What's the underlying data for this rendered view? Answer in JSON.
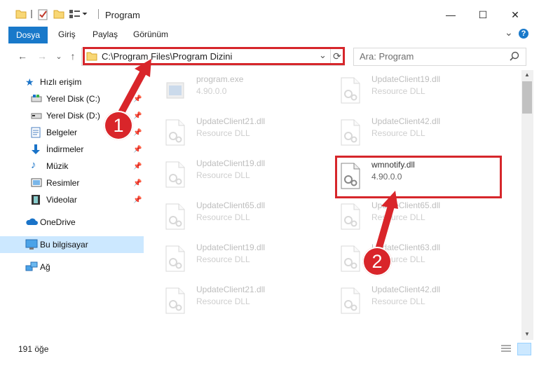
{
  "window": {
    "title": "Program",
    "minimize": "—",
    "maximize": "☐",
    "close": "✕"
  },
  "ribbon": {
    "tabs": [
      "Dosya",
      "Giriş",
      "Paylaş",
      "Görünüm"
    ],
    "expand": "⌄",
    "help": "?"
  },
  "nav": {
    "back": "←",
    "forward": "→",
    "recent": "⌄",
    "up": "↑"
  },
  "address": {
    "path": "C:\\Program Files\\Program Dizini",
    "dropdown": "⌄",
    "refresh": "⟳"
  },
  "search": {
    "placeholder": "Ara: Program",
    "icon": "search-icon"
  },
  "sidebar": {
    "quick_access": "Hızlı erişim",
    "items": [
      {
        "label": "Yerel Disk (C:)",
        "icon": "drive-icon",
        "pinned": true
      },
      {
        "label": "Yerel Disk (D:)",
        "icon": "drive-icon",
        "pinned": true
      },
      {
        "label": "Belgeler",
        "icon": "documents-icon",
        "pinned": true
      },
      {
        "label": "İndirmeler",
        "icon": "download-icon",
        "pinned": true
      },
      {
        "label": "Müzik",
        "icon": "music-icon",
        "pinned": true
      },
      {
        "label": "Resimler",
        "icon": "pictures-icon",
        "pinned": true
      },
      {
        "label": "Videolar",
        "icon": "videos-icon",
        "pinned": true
      }
    ],
    "onedrive": "OneDrive",
    "this_pc": "Bu bilgisayar",
    "network": "Ağ"
  },
  "files": [
    {
      "name": "program.exe",
      "desc": "4.90.0.0"
    },
    {
      "name": "UpdateClient19.dll",
      "desc": "Resource DLL"
    },
    {
      "name": "UpdateClient21.dll",
      "desc": "Resource DLL"
    },
    {
      "name": "UpdateClient42.dll",
      "desc": "Resource DLL"
    },
    {
      "name": "UpdateClient19.dll",
      "desc": "Resource DLL"
    },
    {
      "name": "wmnotify.dll",
      "desc": "4.90.0.0"
    },
    {
      "name": "UpdateClient65.dll",
      "desc": "Resource DLL"
    },
    {
      "name": "UpdateClient65.dll",
      "desc": "Resource DLL"
    },
    {
      "name": "UpdateClient19.dll",
      "desc": "Resource DLL"
    },
    {
      "name": "UpdateClient63.dll",
      "desc": "Resource DLL"
    },
    {
      "name": "UpdateClient21.dll",
      "desc": "Resource DLL"
    },
    {
      "name": "UpdateClient42.dll",
      "desc": "Resource DLL"
    }
  ],
  "status": {
    "count": "191 öğe"
  },
  "markers": {
    "one": "1",
    "two": "2"
  },
  "colors": {
    "accent": "#1979ca",
    "highlight": "#d6262b",
    "selected": "#cce8ff"
  }
}
